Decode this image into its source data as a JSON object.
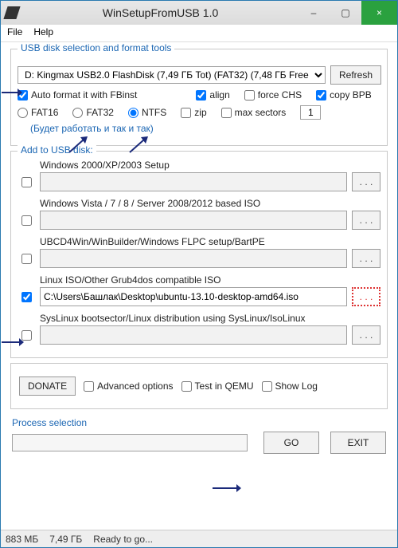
{
  "window": {
    "title": "WinSetupFromUSB 1.0",
    "min": "–",
    "max": "▢",
    "close": "×"
  },
  "menu": {
    "file": "File",
    "help": "Help"
  },
  "usb_group": {
    "legend": "USB disk selection and format tools",
    "disk_selected": "D: Kingmax USB2.0 FlashDisk (7,49 ГБ Tot) (FAT32) (7,48 ГБ Free",
    "refresh": "Refresh",
    "autoformat": "Auto format it with FBinst",
    "fs": {
      "fat16": "FAT16",
      "fat32": "FAT32",
      "ntfs": "NTFS"
    },
    "opts": {
      "align": "align",
      "zip": "zip",
      "forcechs": "force CHS",
      "maxsectors": "max sectors",
      "copybpb": "copy BPB",
      "maxsectors_val": "1"
    },
    "hint": "(Будет работать и так и так)"
  },
  "add": {
    "heading": "Add to USB disk:",
    "sections": [
      {
        "label": "Windows 2000/XP/2003 Setup",
        "value": "",
        "checked": false,
        "hot": false
      },
      {
        "label": "Windows Vista / 7 / 8 / Server 2008/2012 based ISO",
        "value": "",
        "checked": false,
        "hot": false
      },
      {
        "label": "UBCD4Win/WinBuilder/Windows FLPC setup/BartPE",
        "value": "",
        "checked": false,
        "hot": false
      },
      {
        "label": "Linux ISO/Other Grub4dos compatible ISO",
        "value": "C:\\Users\\Башлак\\Desktop\\ubuntu-13.10-desktop-amd64.iso",
        "checked": true,
        "hot": true
      },
      {
        "label": "SysLinux bootsector/Linux distribution using SysLinux/IsoLinux",
        "value": "",
        "checked": false,
        "hot": false
      }
    ],
    "browse": ". . ."
  },
  "bottom": {
    "donate": "DONATE",
    "adv": "Advanced options",
    "qemu": "Test in QEMU",
    "showlog": "Show Log"
  },
  "process": {
    "label": "Process selection",
    "go": "GO",
    "exit": "EXIT"
  },
  "status": {
    "left": "883 МБ",
    "mid": "7,49 ГБ",
    "right": "Ready to go..."
  }
}
